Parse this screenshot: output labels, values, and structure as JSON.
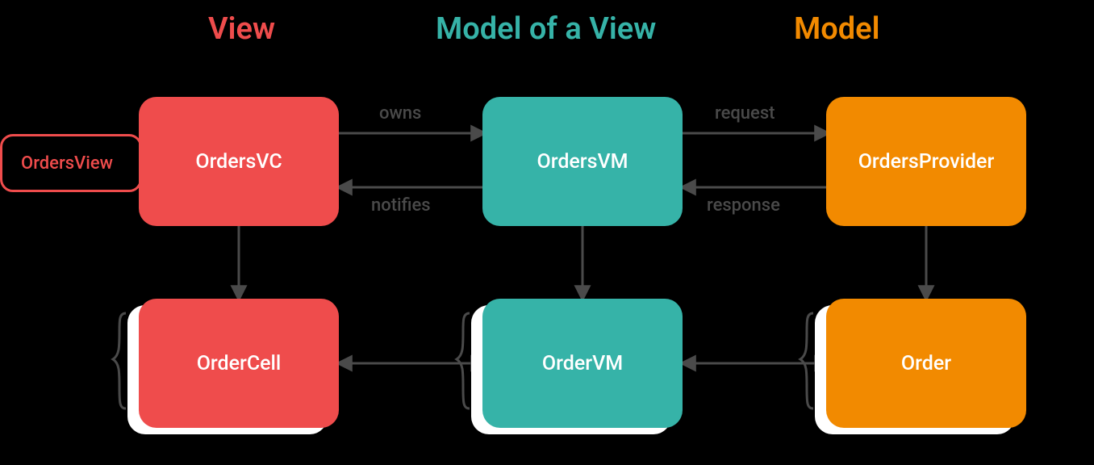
{
  "colors": {
    "red": "#ef4c4c",
    "teal": "#36b3a8",
    "orange": "#f28a00",
    "edge": "#4a4a4a"
  },
  "headings": {
    "view": "View",
    "viewmodel": "Model of a View",
    "model": "Model"
  },
  "boxes": {
    "ordersView": "OrdersView",
    "ordersVC": "OrdersVC",
    "ordersVM": "OrdersVM",
    "ordersProvider": "OrdersProvider",
    "orderCell": "OrderCell",
    "orderVM": "OrderVM",
    "order": "Order"
  },
  "edges": {
    "owns": "owns",
    "notifies": "notifies",
    "request": "request",
    "response": "response"
  }
}
